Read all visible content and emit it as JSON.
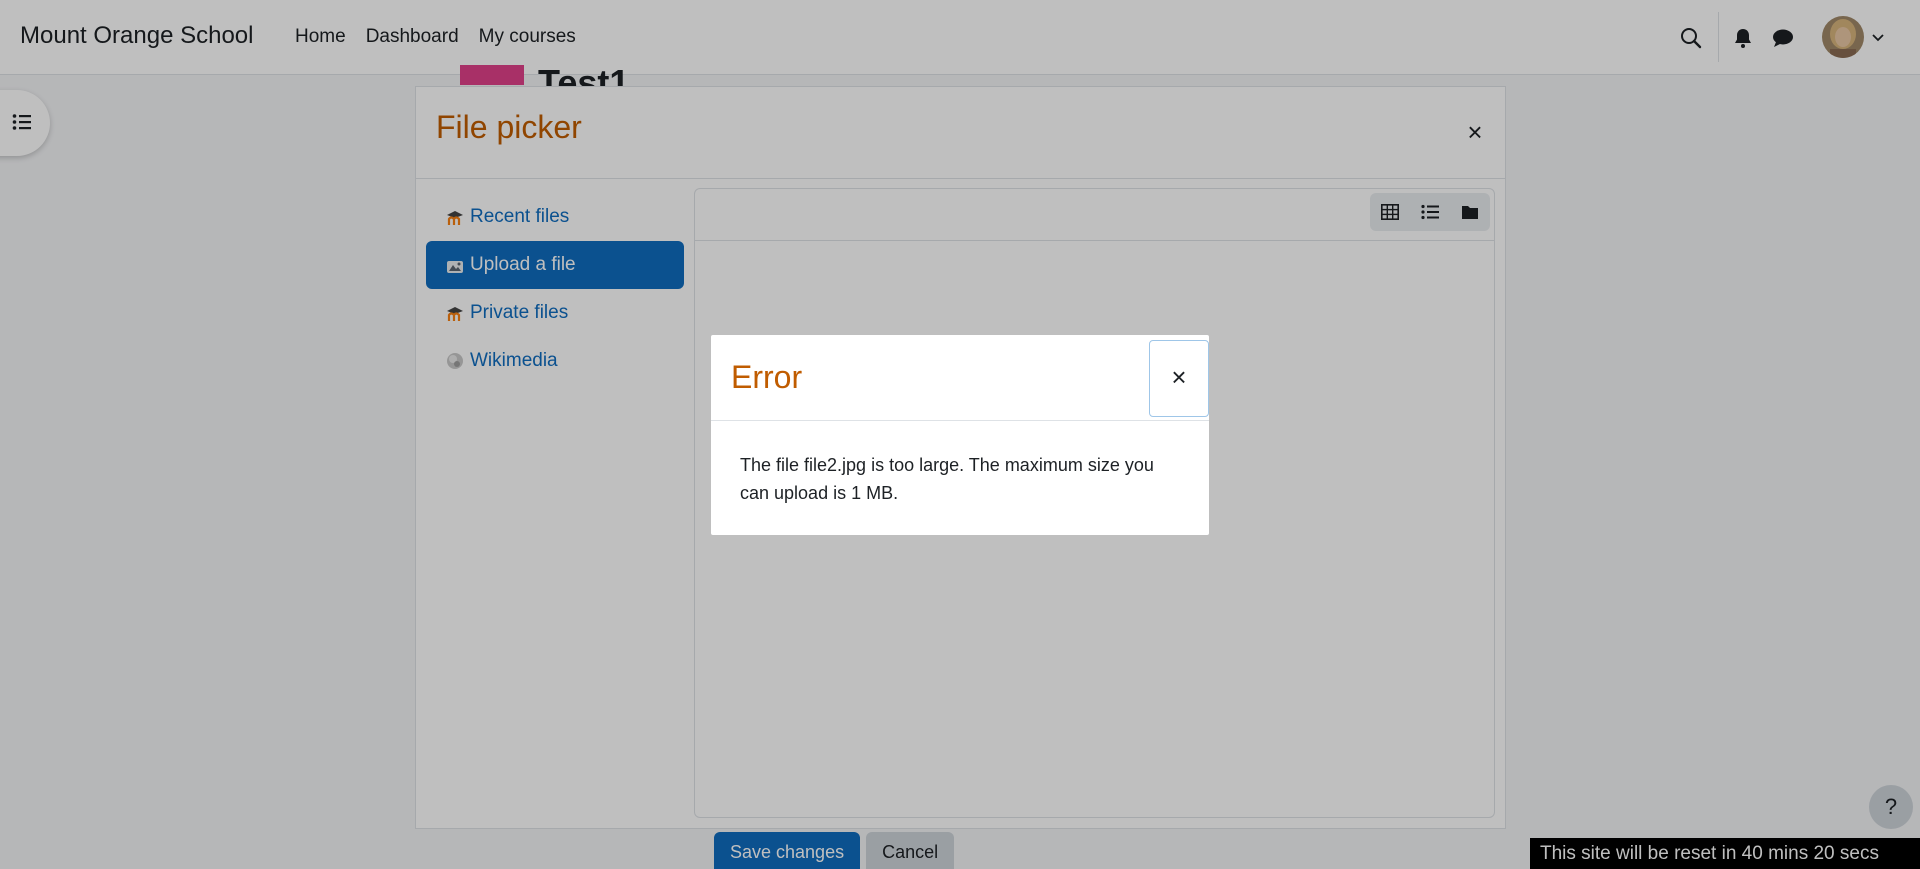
{
  "navbar": {
    "brand": "Mount Orange School",
    "links": [
      "Home",
      "Dashboard",
      "My courses"
    ]
  },
  "page": {
    "course_title": "Test1"
  },
  "file_picker": {
    "title": "File picker",
    "repositories": [
      {
        "label": "Recent files",
        "icon": "moodle-icon",
        "active": false
      },
      {
        "label": "Upload a file",
        "icon": "upload-icon",
        "active": true
      },
      {
        "label": "Private files",
        "icon": "moodle-icon",
        "active": false
      },
      {
        "label": "Wikimedia",
        "icon": "globe-icon",
        "active": false
      }
    ],
    "view_modes": [
      "grid-view-icon",
      "list-view-icon",
      "folder-view-icon"
    ]
  },
  "form_buttons": {
    "save_label": "Save changes",
    "cancel_label": "Cancel"
  },
  "error_dialog": {
    "title": "Error",
    "message": "The file file2.jpg is too large. The maximum size you can upload is 1 MB."
  },
  "help_button": {
    "label": "?"
  },
  "reset_banner": "This site will be reset in 40 mins 20 secs",
  "colors": {
    "primary": "#0f6cbf",
    "heading_orange": "#c05c00",
    "course_icon_pink": "#e0408a"
  }
}
